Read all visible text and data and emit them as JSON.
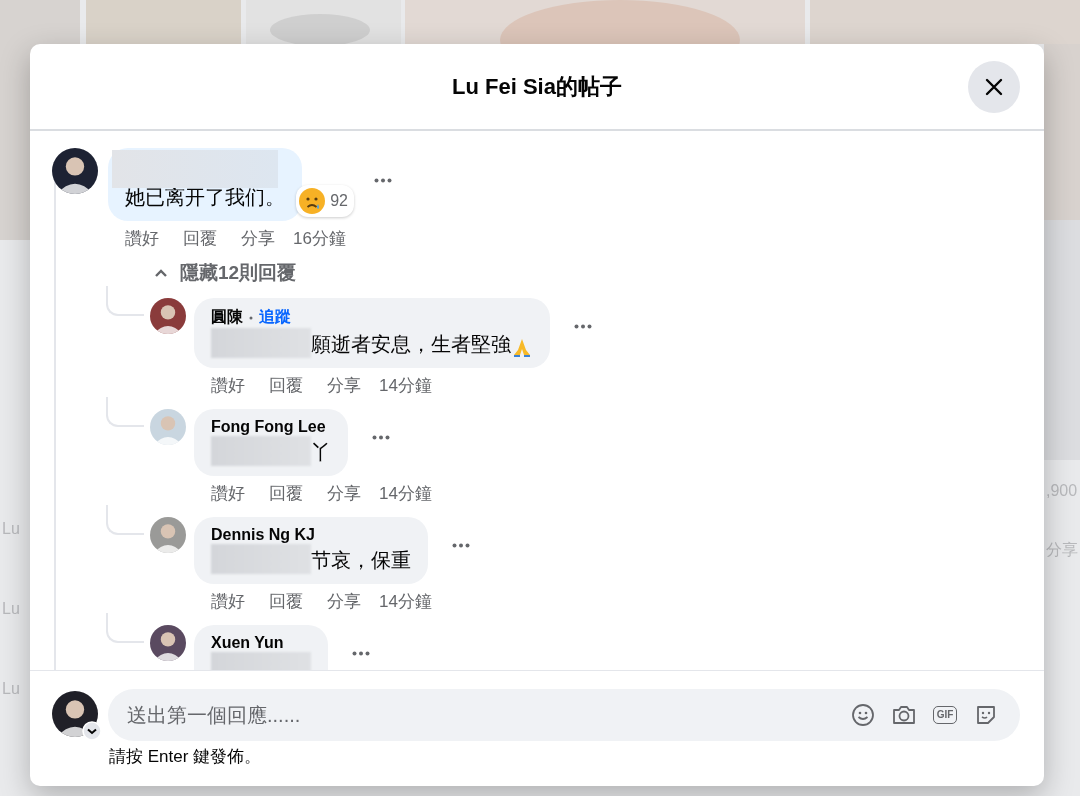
{
  "background": {
    "left_texts": [
      "Lu",
      "Lu",
      "Lu"
    ],
    "right_texts": [
      ",900",
      "分享"
    ]
  },
  "dialog": {
    "title": "Lu Fei Sia的帖子"
  },
  "post_comment": {
    "author_redacted": true,
    "text": "她已离开了我们。",
    "reaction_count": "92",
    "actions": [
      "讚好",
      "回覆",
      "分享"
    ],
    "time": "16分鐘",
    "toggle": "隱藏12則回覆",
    "expanded": true
  },
  "replies": [
    {
      "author": "圓陳",
      "follow": "追蹤",
      "redacted": true,
      "text": "願逝者安息，生者堅強",
      "trailing_icon": {
        "kind": "pray"
      },
      "actions": [
        "讚好",
        "回覆",
        "分享"
      ],
      "time": "14分鐘"
    },
    {
      "author": "Fong Fong Lee",
      "redacted": true,
      "text": "丫",
      "actions": [
        "讚好",
        "回覆",
        "分享"
      ],
      "time": "14分鐘"
    },
    {
      "author": "Dennis Ng KJ",
      "redacted": true,
      "text": "节哀，保重",
      "actions": [
        "讚好",
        "回覆",
        "分享"
      ],
      "time": "14分鐘"
    },
    {
      "author": "Xuen Yun",
      "redacted": true
    }
  ],
  "composer": {
    "placeholder": "送出第一個回應......",
    "tools": [
      {
        "kind": "emoji"
      },
      {
        "kind": "camera"
      },
      {
        "kind": "gif",
        "label": "GIF"
      },
      {
        "kind": "sticker"
      }
    ],
    "hint": "請按 Enter 鍵發佈。"
  }
}
